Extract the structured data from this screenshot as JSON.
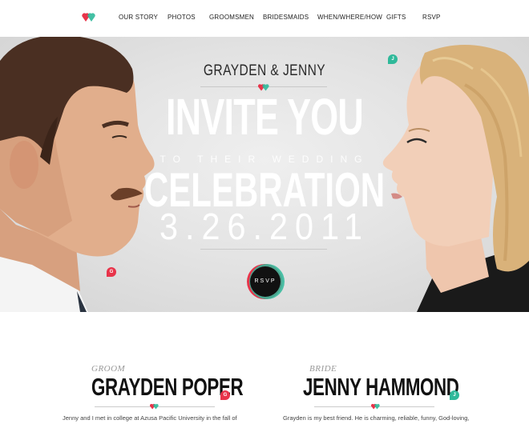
{
  "nav": {
    "items": [
      {
        "label": "OUR STORY"
      },
      {
        "label": "PHOTOS"
      },
      {
        "label": "GROOMSMEN"
      },
      {
        "label": "BRIDESMAIDS"
      },
      {
        "label": "WHEN/WHERE/HOW"
      },
      {
        "label": "GIFTS"
      },
      {
        "label": "RSVP"
      }
    ]
  },
  "hero": {
    "names": "GRAYDEN & JENNY",
    "headline_1": "INVITE YOU",
    "headline_sub": "TO THEIR WEDDING",
    "headline_2": "CELEBRATION",
    "date": "3.26.2011",
    "rsvp_label": "RSVP",
    "groom_tag": "G",
    "bride_tag": "J"
  },
  "groom": {
    "role": "GROOM",
    "name": "GRAYDEN POPER",
    "tag": "G",
    "intro": "Jenny and I met in college at Azusa Pacific University in the fall of"
  },
  "bride": {
    "role": "BRIDE",
    "name": "JENNY HAMMOND",
    "tag": "J",
    "intro": "Grayden is my best friend. He is charming, reliable, funny, God-loving,"
  },
  "colors": {
    "red": "#e8344a",
    "teal": "#2fb99a",
    "dark": "#111111"
  }
}
